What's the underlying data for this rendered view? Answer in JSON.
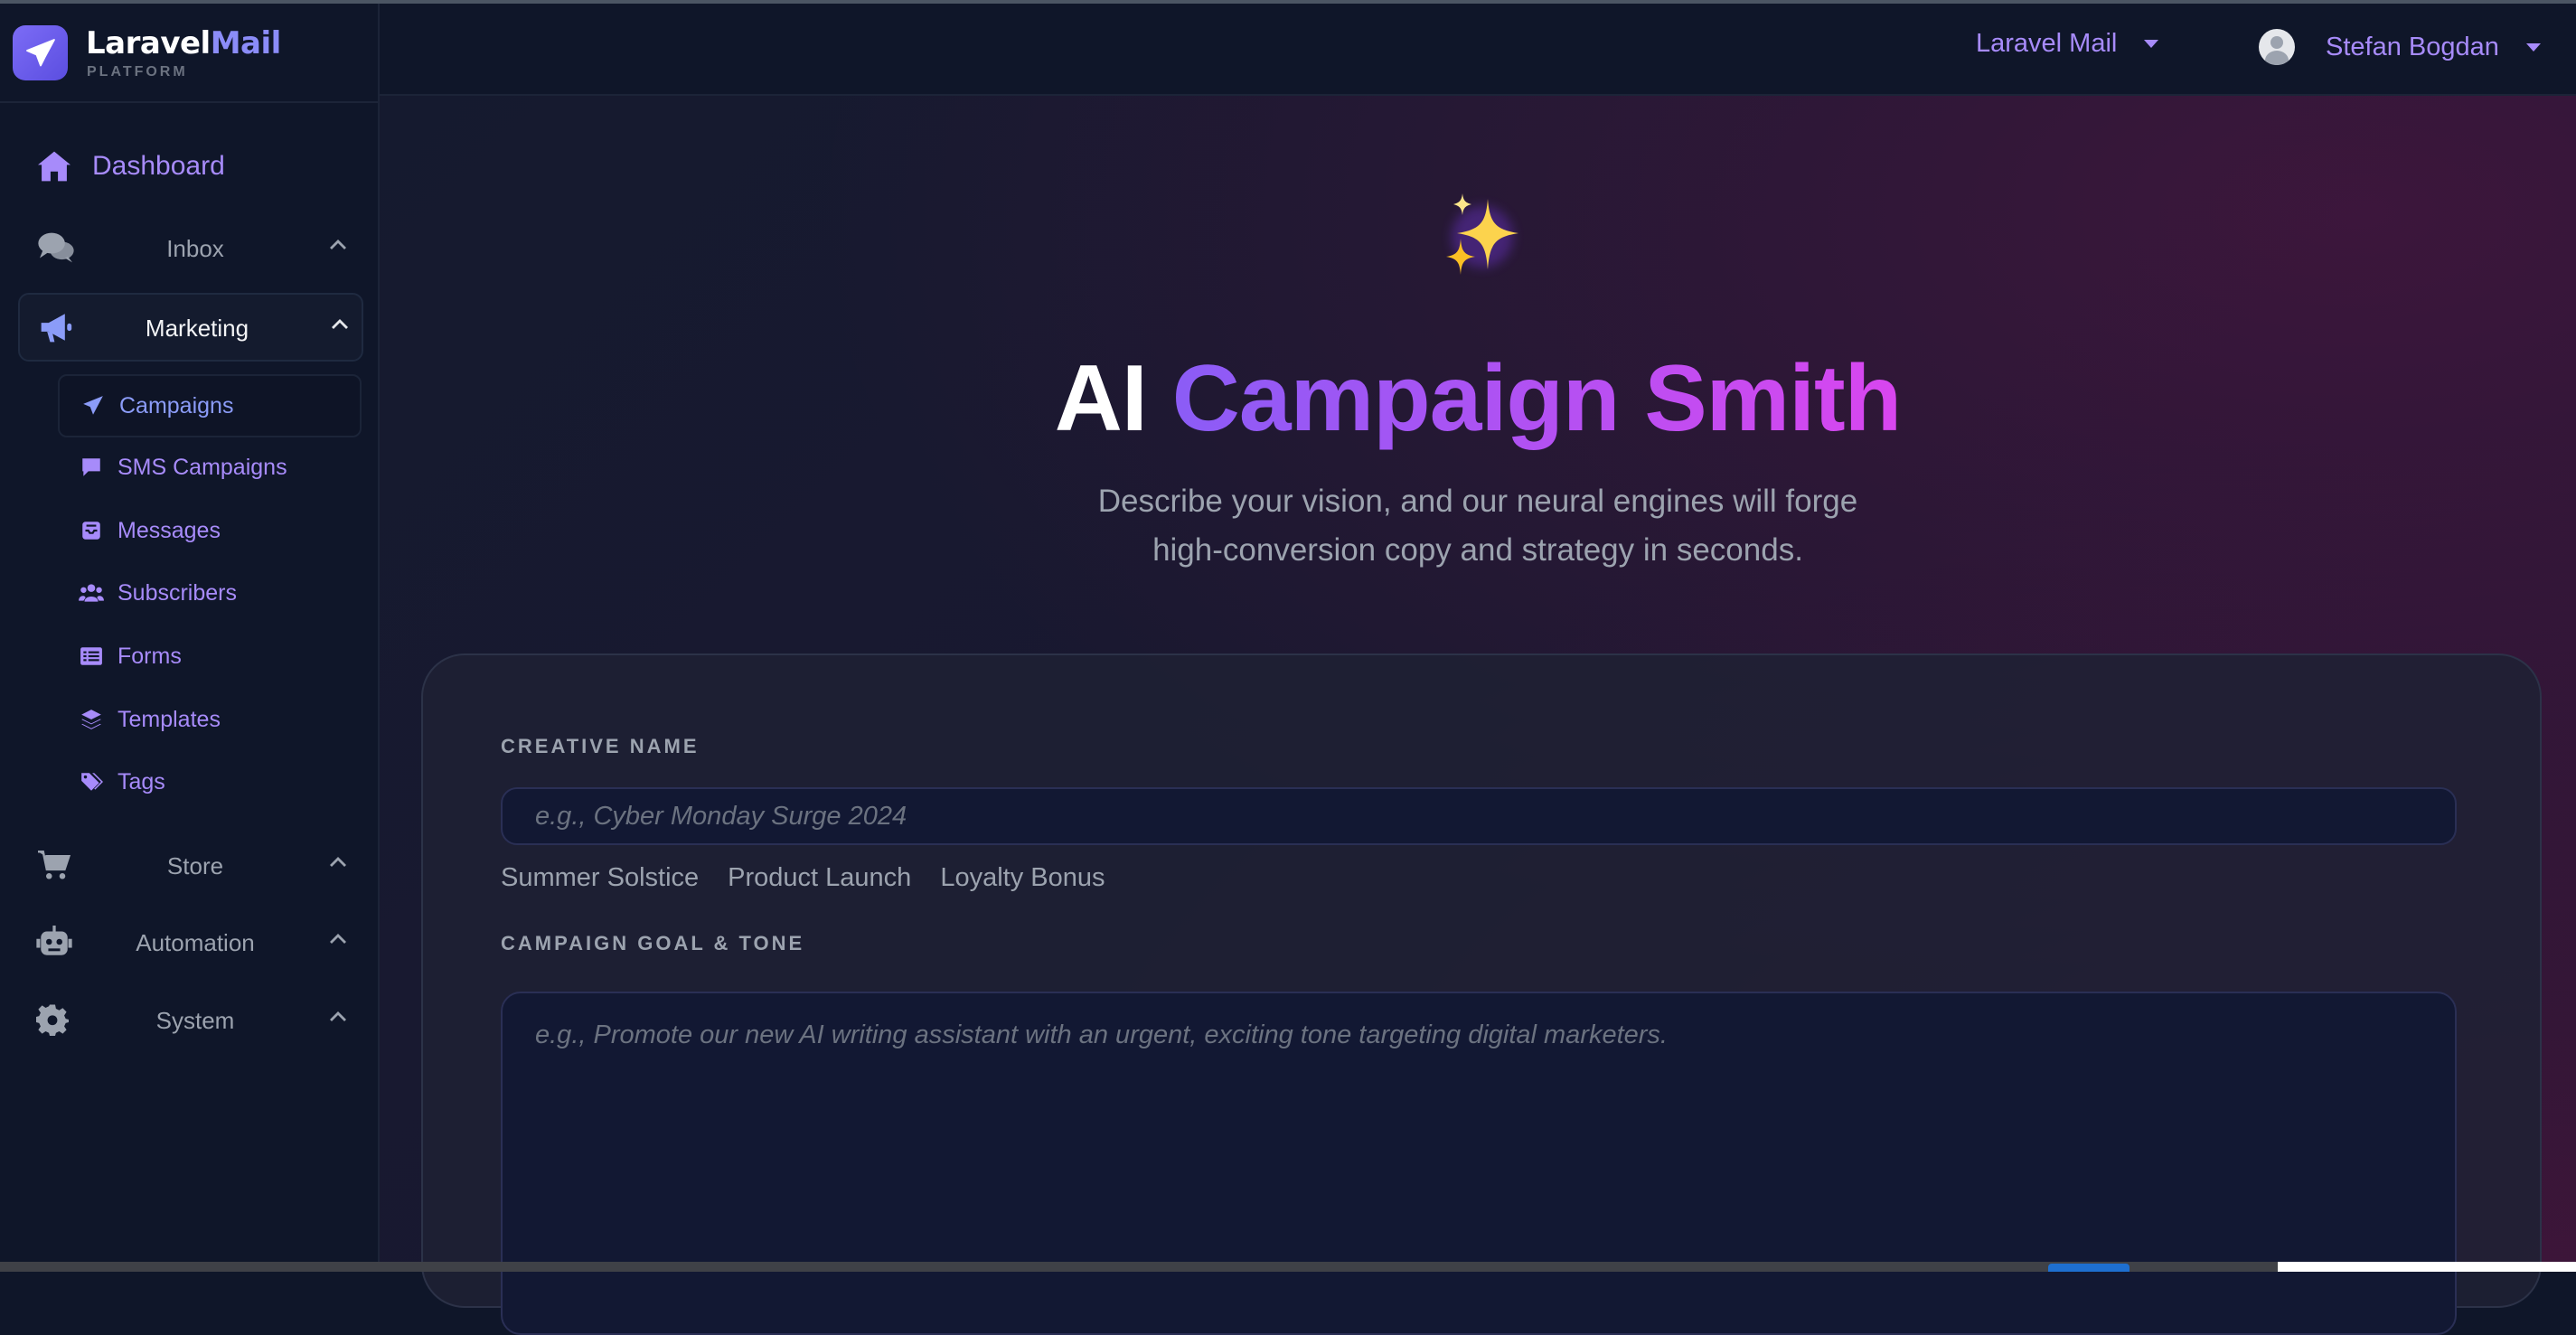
{
  "brand": {
    "name_main": "Laravel",
    "name_accent": "Mail",
    "subtitle": "PLATFORM"
  },
  "nav": {
    "dashboard": "Dashboard",
    "groups": {
      "inbox": "Inbox",
      "marketing": "Marketing",
      "store": "Store",
      "automation": "Automation",
      "system": "System"
    },
    "marketing_items": [
      "Campaigns",
      "SMS Campaigns",
      "Messages",
      "Subscribers",
      "Forms",
      "Templates",
      "Tags"
    ],
    "active_item": "Campaigns"
  },
  "header": {
    "workspace": "Laravel Mail",
    "user": "Stefan Bogdan"
  },
  "hero": {
    "icon": "sparkles-icon",
    "title_plain": "AI",
    "title_gradient": "Campaign Smith",
    "subtitle_line1": "Describe your vision, and our neural engines will forge",
    "subtitle_line2": "high-conversion copy and strategy in seconds."
  },
  "form": {
    "creative_name_label": "CREATIVE NAME",
    "creative_name_placeholder": "e.g., Cyber Monday Surge 2024",
    "creative_name_value": "",
    "suggestions": [
      "Summer Solstice",
      "Product Launch",
      "Loyalty Bonus"
    ],
    "goal_label": "CAMPAIGN GOAL & TONE",
    "goal_placeholder": "e.g., Promote our new AI writing assistant with an urgent, exciting tone targeting digital marketers.",
    "goal_value": ""
  },
  "colors": {
    "accent": "#a78bfa",
    "brand": "#7c6cf6",
    "gradient_start": "#8b5cf6",
    "gradient_end": "#d946ef"
  }
}
